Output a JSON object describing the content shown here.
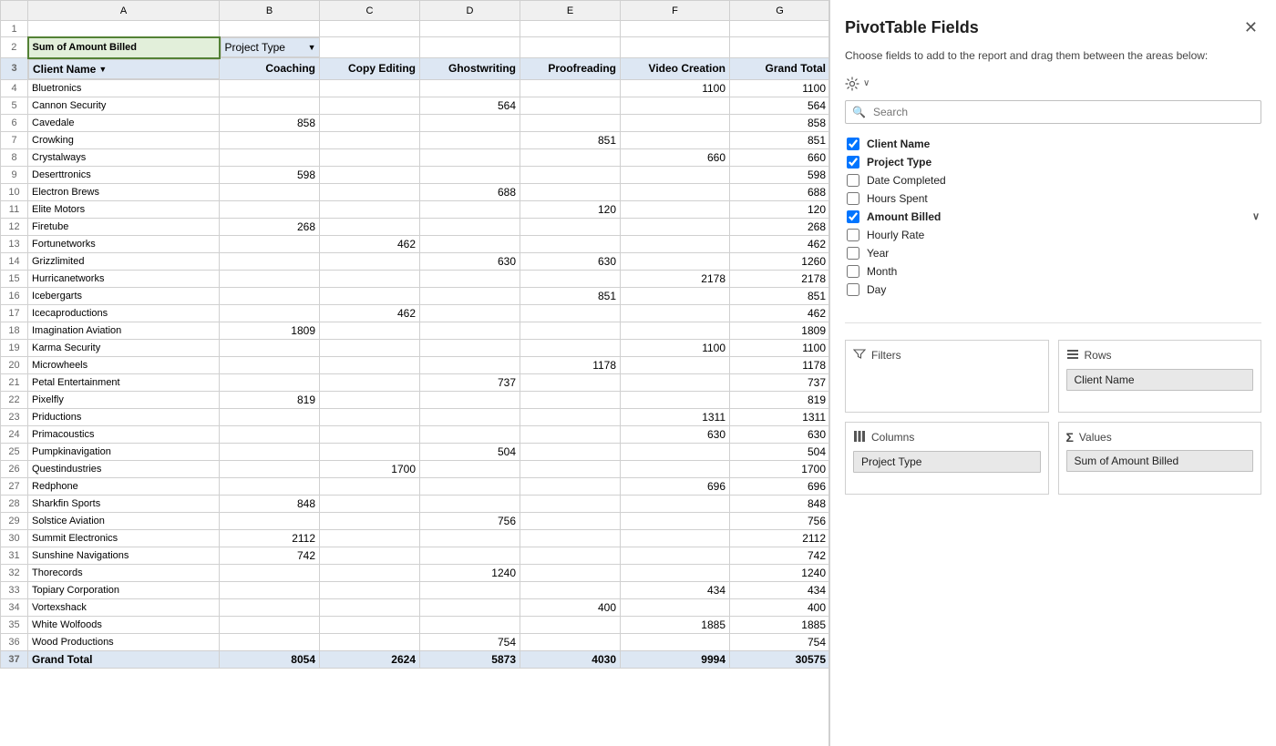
{
  "spreadsheet": {
    "col_headers": [
      "",
      "A",
      "B",
      "C",
      "D",
      "E",
      "F",
      "G"
    ],
    "row2": {
      "a2": "Sum of Amount Billed",
      "b2": "Project Type",
      "b2_dropdown": "▼"
    },
    "row3": {
      "a3": "Client Name",
      "a3_dropdown": "▼",
      "b3": "Coaching",
      "c3": "Copy Editing",
      "d3": "Ghostwriting",
      "e3": "Proofreading",
      "f3": "Video Creation",
      "g3": "Grand Total"
    },
    "rows": [
      {
        "num": 4,
        "name": "Bluetronics",
        "coaching": "",
        "copy_editing": "",
        "ghostwriting": "",
        "proofreading": "",
        "video_creation": "1100",
        "grand_total": "1100"
      },
      {
        "num": 5,
        "name": "Cannon Security",
        "coaching": "",
        "copy_editing": "",
        "ghostwriting": "564",
        "proofreading": "",
        "video_creation": "",
        "grand_total": "564"
      },
      {
        "num": 6,
        "name": "Cavedale",
        "coaching": "858",
        "copy_editing": "",
        "ghostwriting": "",
        "proofreading": "",
        "video_creation": "",
        "grand_total": "858"
      },
      {
        "num": 7,
        "name": "Crowking",
        "coaching": "",
        "copy_editing": "",
        "ghostwriting": "",
        "proofreading": "851",
        "video_creation": "",
        "grand_total": "851"
      },
      {
        "num": 8,
        "name": "Crystalways",
        "coaching": "",
        "copy_editing": "",
        "ghostwriting": "",
        "proofreading": "",
        "video_creation": "660",
        "grand_total": "660"
      },
      {
        "num": 9,
        "name": "Deserttronics",
        "coaching": "598",
        "copy_editing": "",
        "ghostwriting": "",
        "proofreading": "",
        "video_creation": "",
        "grand_total": "598"
      },
      {
        "num": 10,
        "name": "Electron Brews",
        "coaching": "",
        "copy_editing": "",
        "ghostwriting": "688",
        "proofreading": "",
        "video_creation": "",
        "grand_total": "688"
      },
      {
        "num": 11,
        "name": "Elite Motors",
        "coaching": "",
        "copy_editing": "",
        "ghostwriting": "",
        "proofreading": "120",
        "video_creation": "",
        "grand_total": "120"
      },
      {
        "num": 12,
        "name": "Firetube",
        "coaching": "268",
        "copy_editing": "",
        "ghostwriting": "",
        "proofreading": "",
        "video_creation": "",
        "grand_total": "268"
      },
      {
        "num": 13,
        "name": "Fortunetworks",
        "coaching": "",
        "copy_editing": "462",
        "ghostwriting": "",
        "proofreading": "",
        "video_creation": "",
        "grand_total": "462"
      },
      {
        "num": 14,
        "name": "Grizzlimited",
        "coaching": "",
        "copy_editing": "",
        "ghostwriting": "630",
        "proofreading": "630",
        "video_creation": "",
        "grand_total": "1260"
      },
      {
        "num": 15,
        "name": "Hurricanetworks",
        "coaching": "",
        "copy_editing": "",
        "ghostwriting": "",
        "proofreading": "",
        "video_creation": "2178",
        "grand_total": "2178"
      },
      {
        "num": 16,
        "name": "Icebergarts",
        "coaching": "",
        "copy_editing": "",
        "ghostwriting": "",
        "proofreading": "851",
        "video_creation": "",
        "grand_total": "851"
      },
      {
        "num": 17,
        "name": "Icecaproductions",
        "coaching": "",
        "copy_editing": "462",
        "ghostwriting": "",
        "proofreading": "",
        "video_creation": "",
        "grand_total": "462"
      },
      {
        "num": 18,
        "name": "Imagination Aviation",
        "coaching": "1809",
        "copy_editing": "",
        "ghostwriting": "",
        "proofreading": "",
        "video_creation": "",
        "grand_total": "1809"
      },
      {
        "num": 19,
        "name": "Karma Security",
        "coaching": "",
        "copy_editing": "",
        "ghostwriting": "",
        "proofreading": "",
        "video_creation": "1100",
        "grand_total": "1100"
      },
      {
        "num": 20,
        "name": "Microwheels",
        "coaching": "",
        "copy_editing": "",
        "ghostwriting": "",
        "proofreading": "1178",
        "video_creation": "",
        "grand_total": "1178"
      },
      {
        "num": 21,
        "name": "Petal Entertainment",
        "coaching": "",
        "copy_editing": "",
        "ghostwriting": "737",
        "proofreading": "",
        "video_creation": "",
        "grand_total": "737"
      },
      {
        "num": 22,
        "name": "Pixelfly",
        "coaching": "819",
        "copy_editing": "",
        "ghostwriting": "",
        "proofreading": "",
        "video_creation": "",
        "grand_total": "819"
      },
      {
        "num": 23,
        "name": "Priductions",
        "coaching": "",
        "copy_editing": "",
        "ghostwriting": "",
        "proofreading": "",
        "video_creation": "1311",
        "grand_total": "1311"
      },
      {
        "num": 24,
        "name": "Primacoustics",
        "coaching": "",
        "copy_editing": "",
        "ghostwriting": "",
        "proofreading": "",
        "video_creation": "630",
        "grand_total": "630"
      },
      {
        "num": 25,
        "name": "Pumpkinavigation",
        "coaching": "",
        "copy_editing": "",
        "ghostwriting": "504",
        "proofreading": "",
        "video_creation": "",
        "grand_total": "504"
      },
      {
        "num": 26,
        "name": "Questindustries",
        "coaching": "",
        "copy_editing": "1700",
        "ghostwriting": "",
        "proofreading": "",
        "video_creation": "",
        "grand_total": "1700"
      },
      {
        "num": 27,
        "name": "Redphone",
        "coaching": "",
        "copy_editing": "",
        "ghostwriting": "",
        "proofreading": "",
        "video_creation": "696",
        "grand_total": "696"
      },
      {
        "num": 28,
        "name": "Sharkfin Sports",
        "coaching": "848",
        "copy_editing": "",
        "ghostwriting": "",
        "proofreading": "",
        "video_creation": "",
        "grand_total": "848"
      },
      {
        "num": 29,
        "name": "Solstice Aviation",
        "coaching": "",
        "copy_editing": "",
        "ghostwriting": "756",
        "proofreading": "",
        "video_creation": "",
        "grand_total": "756"
      },
      {
        "num": 30,
        "name": "Summit Electronics",
        "coaching": "2112",
        "copy_editing": "",
        "ghostwriting": "",
        "proofreading": "",
        "video_creation": "",
        "grand_total": "2112"
      },
      {
        "num": 31,
        "name": "Sunshine Navigations",
        "coaching": "742",
        "copy_editing": "",
        "ghostwriting": "",
        "proofreading": "",
        "video_creation": "",
        "grand_total": "742"
      },
      {
        "num": 32,
        "name": "Thorecords",
        "coaching": "",
        "copy_editing": "",
        "ghostwriting": "1240",
        "proofreading": "",
        "video_creation": "",
        "grand_total": "1240"
      },
      {
        "num": 33,
        "name": "Topiary Corporation",
        "coaching": "",
        "copy_editing": "",
        "ghostwriting": "",
        "proofreading": "",
        "video_creation": "434",
        "grand_total": "434"
      },
      {
        "num": 34,
        "name": "Vortexshack",
        "coaching": "",
        "copy_editing": "",
        "ghostwriting": "",
        "proofreading": "400",
        "video_creation": "",
        "grand_total": "400"
      },
      {
        "num": 35,
        "name": "White Wolfoods",
        "coaching": "",
        "copy_editing": "",
        "ghostwriting": "",
        "proofreading": "",
        "video_creation": "1885",
        "grand_total": "1885"
      },
      {
        "num": 36,
        "name": "Wood Productions",
        "coaching": "",
        "copy_editing": "",
        "ghostwriting": "754",
        "proofreading": "",
        "video_creation": "",
        "grand_total": "754"
      }
    ],
    "grand_total_row": {
      "num": 37,
      "label": "Grand Total",
      "coaching": "8054",
      "copy_editing": "2624",
      "ghostwriting": "5873",
      "proofreading": "4030",
      "video_creation": "9994",
      "grand_total": "30575"
    }
  },
  "pivot_panel": {
    "title": "PivotTable Fields",
    "description": "Choose fields to add to the report and drag them between the areas below:",
    "close_label": "✕",
    "search_placeholder": "Search",
    "fields": [
      {
        "id": "client_name",
        "label": "Client Name",
        "checked": true,
        "bold": true,
        "has_expand": false
      },
      {
        "id": "project_type",
        "label": "Project Type",
        "checked": true,
        "bold": true,
        "has_expand": false
      },
      {
        "id": "date_completed",
        "label": "Date Completed",
        "checked": false,
        "bold": false,
        "has_expand": false
      },
      {
        "id": "hours_spent",
        "label": "Hours Spent",
        "checked": false,
        "bold": false,
        "has_expand": false
      },
      {
        "id": "amount_billed",
        "label": "Amount Billed",
        "checked": true,
        "bold": true,
        "has_expand": true
      },
      {
        "id": "hourly_rate",
        "label": "Hourly Rate",
        "checked": false,
        "bold": false,
        "has_expand": false
      },
      {
        "id": "year",
        "label": "Year",
        "checked": false,
        "bold": false,
        "has_expand": false
      },
      {
        "id": "month",
        "label": "Month",
        "checked": false,
        "bold": false,
        "has_expand": false
      },
      {
        "id": "day",
        "label": "Day",
        "checked": false,
        "bold": false,
        "has_expand": false
      }
    ],
    "areas": {
      "filters": {
        "label": "Filters",
        "icon": "≡",
        "value": ""
      },
      "rows": {
        "label": "Rows",
        "icon": "☰",
        "value": "Client Name"
      },
      "columns": {
        "label": "Columns",
        "icon": "⊞",
        "value": "Project Type"
      },
      "values": {
        "label": "Values",
        "icon": "Σ",
        "value": "Sum of Amount Billed"
      }
    }
  }
}
